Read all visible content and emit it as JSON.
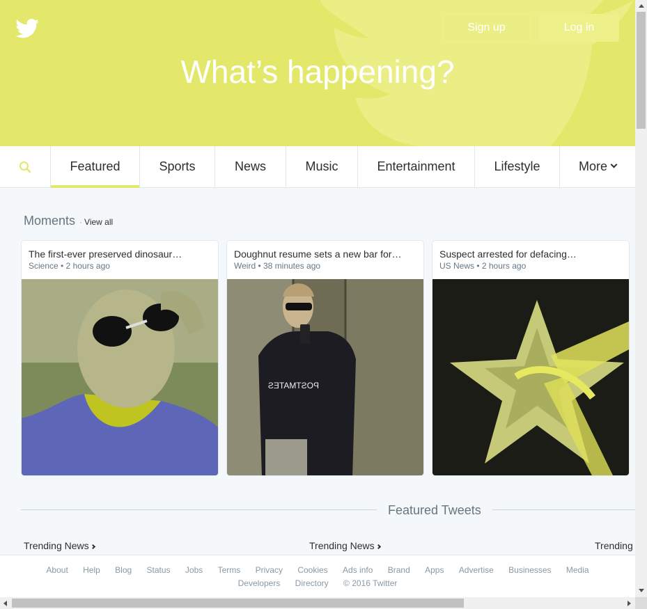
{
  "header": {
    "title": "What’s happening?",
    "signup_label": "Sign up",
    "login_label": "Log in",
    "logo": "twitter-bird-icon"
  },
  "colors": {
    "accent": "#e3e86a",
    "text": "#292f33",
    "muted": "#66757f",
    "border": "#e1e8ed"
  },
  "nav": {
    "search_icon": "search-icon",
    "tabs": [
      {
        "label": "Featured",
        "active": true
      },
      {
        "label": "Sports"
      },
      {
        "label": "News"
      },
      {
        "label": "Music"
      },
      {
        "label": "Entertainment"
      },
      {
        "label": "Lifestyle"
      },
      {
        "label": "More"
      }
    ]
  },
  "moments": {
    "title": "Moments",
    "view_all": "View all",
    "cards": [
      {
        "title": "The first-ever preserved dinosaur…",
        "category": "Science",
        "time": "2 hours ago",
        "meta": "Science • 2 hours ago"
      },
      {
        "title": "Doughnut resume sets a new bar for…",
        "category": "Weird",
        "time": "38 minutes ago",
        "meta": "Weird • 38 minutes ago"
      },
      {
        "title": "Suspect arrested for defacing…",
        "category": "US News",
        "time": "2 hours ago",
        "meta": "US News • 2 hours ago"
      }
    ]
  },
  "featured_tweets": {
    "title": "Featured Tweets",
    "trending": [
      {
        "label": "Trending News"
      },
      {
        "label": "Trending News"
      },
      {
        "label": "Trending N"
      }
    ]
  },
  "footer": {
    "links_row1": [
      "About",
      "Help",
      "Blog",
      "Status",
      "Jobs",
      "Terms",
      "Privacy",
      "Cookies",
      "Ads info",
      "Brand",
      "Apps",
      "Advertise",
      "Businesses",
      "Media"
    ],
    "links_row2": [
      "Developers",
      "Directory",
      "© 2016 Twitter"
    ]
  }
}
